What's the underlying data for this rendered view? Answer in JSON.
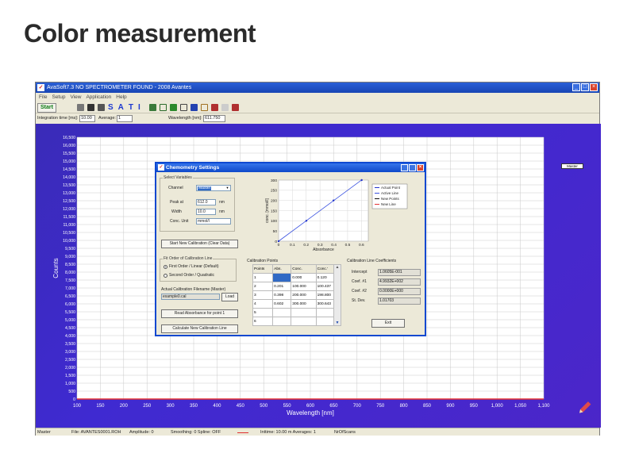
{
  "slide": {
    "title": "Color measurement"
  },
  "window": {
    "title": "AvaSoft7.3 NO SPECTROMETER FOUND - 2008 Avantes",
    "icon": "avantes-check-icon",
    "controls": [
      "minimize",
      "maximize",
      "close"
    ]
  },
  "menu": [
    "File",
    "Setup",
    "View",
    "Application",
    "Help"
  ],
  "toolbar": {
    "start_label": "Start",
    "sati_letters": [
      "S",
      "A",
      "T",
      "I"
    ]
  },
  "params": {
    "integration_label": "Integration time [ms]:",
    "integration_value": "10.00",
    "average_label": "Average:",
    "average_value": "1",
    "wavelength_label": "Wavelength [nm]:",
    "wavelength_value": "611.750"
  },
  "main_chart": {
    "chart_data": {
      "type": "line",
      "title": "",
      "xlabel": "Wavelength [nm]",
      "ylabel": "Counts",
      "x_ticks": [
        100,
        150,
        200,
        250,
        300,
        350,
        400,
        450,
        500,
        550,
        600,
        650,
        700,
        750,
        800,
        850,
        900,
        950,
        1000,
        1050,
        1100
      ],
      "x_tick_labels": [
        "100",
        "150",
        "200",
        "250",
        "300",
        "350",
        "400",
        "450",
        "500",
        "550",
        "600",
        "650",
        "700",
        "750",
        "800",
        "850",
        "900",
        "950",
        "1,000",
        "1,050",
        "1,100"
      ],
      "y_ticks": [
        0,
        500,
        1000,
        1500,
        2000,
        2500,
        3000,
        3500,
        4000,
        4500,
        5000,
        5500,
        6000,
        6500,
        7000,
        7500,
        8000,
        8500,
        9000,
        9500,
        10000,
        10500,
        11000,
        11500,
        12000,
        12500,
        13000,
        13500,
        14000,
        14500,
        15000,
        15500,
        16000,
        16500
      ],
      "y_tick_labels": [
        "0",
        "500",
        "1,000",
        "1,500",
        "2,000",
        "2,500",
        "3,000",
        "3,500",
        "4,000",
        "4,500",
        "5,000",
        "5,500",
        "6,000",
        "6,500",
        "7,000",
        "7,500",
        "8,000",
        "8,500",
        "9,000",
        "9,500",
        "10,000",
        "10,500",
        "11,000",
        "11,500",
        "12,000",
        "12,500",
        "13,000",
        "13,500",
        "14,000",
        "14,500",
        "15,000",
        "15,500",
        "16,000",
        "16,500"
      ],
      "xlim": [
        100,
        1100
      ],
      "ylim": [
        0,
        16500
      ],
      "grid": true,
      "series": [
        {
          "name": "Master",
          "x": [
            100,
            1100
          ],
          "y": [
            0,
            0
          ],
          "color": "#e53030"
        }
      ]
    },
    "legend_label": "Master"
  },
  "status": {
    "mode": "Master",
    "file": "File: AVANTES0001.ROH",
    "amplitude": "Amplitude: 0",
    "smoothing": "Smoothing: 0 Spline: OFF",
    "inttime": "Inttime: 10.00 m Averages: 1",
    "nrofscans": "NrOfScans"
  },
  "dialog": {
    "title": "Chemometry Settings",
    "select_variables": {
      "group_title": "Select Variables",
      "channel_label": "Channel",
      "channel_value": "Master",
      "peak_label": "Peak at",
      "peak_value": "612.0",
      "peak_unit": "nm",
      "width_label": "Width",
      "width_value": "10.0",
      "width_unit": "nm",
      "conc_label": "Conc. Unit",
      "conc_value": "mmol/l"
    },
    "start_new_button": "Start New Calibration (Clear Data)",
    "fit_order": {
      "group_title": "Fit Order of Calibration Line",
      "option1": "First Order / Linear (Default)",
      "option2": "Second Order / Quadratic"
    },
    "filename_label": "Actual Calibration Filename (Master)",
    "filename_value": "example0.cal",
    "load_button": "Load",
    "read_button": "Read Absorbance for point 1",
    "calculate_button": "Calculate New Calibration Line",
    "calibration_chart": {
      "chart_data": {
        "type": "line",
        "title": "",
        "xlabel": "Absorbance",
        "ylabel": "conc. [mmol/l]",
        "xlim": [
          0,
          0.65
        ],
        "ylim": [
          0,
          300
        ],
        "x_ticks": [
          0,
          0.1,
          0.2,
          0.3,
          0.4,
          0.5,
          0.6
        ],
        "x_tick_labels": [
          "0",
          "0.1",
          "0.2",
          "0.3",
          "0.4",
          "0.5",
          "0.6"
        ],
        "y_ticks": [
          0,
          50,
          100,
          150,
          200,
          250,
          300
        ],
        "y_tick_labels": [
          "0",
          "50",
          "100",
          "150",
          "200",
          "250",
          "300"
        ],
        "grid": true,
        "legend": [
          "Actual Point",
          "Active Line",
          "New Points",
          "New Line"
        ],
        "legend_colors": [
          "#2233cc",
          "#3a52e0",
          "#111111",
          "#e33333"
        ],
        "series": [
          {
            "name": "Active Line",
            "x": [
              0,
              0.201,
              0.398,
              0.602
            ],
            "y": [
              0.0,
              100.4,
              198.8,
              300.6
            ],
            "color": "#3a52e0"
          },
          {
            "name": "Actual Point",
            "x": [
              0,
              0.201,
              0.398,
              0.602
            ],
            "y": [
              0,
              100,
              200,
              300
            ],
            "color": "#2233cc"
          }
        ]
      }
    },
    "calibration_points": {
      "group_title": "Calibration Points",
      "columns": [
        "Points",
        "Abs.",
        "Conc.",
        "Conc.'"
      ],
      "rows": [
        [
          "1",
          "",
          "0.000",
          "0.120"
        ],
        [
          "2",
          "0.201",
          "100.000",
          "100.437"
        ],
        [
          "3",
          "0.398",
          "200.000",
          "198.800"
        ],
        [
          "4",
          "0.602",
          "300.000",
          "300.643"
        ],
        [
          "5",
          "",
          "",
          ""
        ],
        [
          "6",
          "",
          "",
          ""
        ]
      ]
    },
    "coefficients": {
      "group_title": "Calibration Line Coefficients",
      "intercept_label": "Intercept",
      "intercept_value": "1.0605E-001",
      "coef1_label": "Coef. #1",
      "coef1_value": "4.9932E+002",
      "coef2_label": "Coef. #2",
      "coef2_value": "0.0000E+000",
      "stdev_label": "St. Dev.",
      "stdev_value": "1.01703"
    },
    "exit_button": "Exit"
  }
}
